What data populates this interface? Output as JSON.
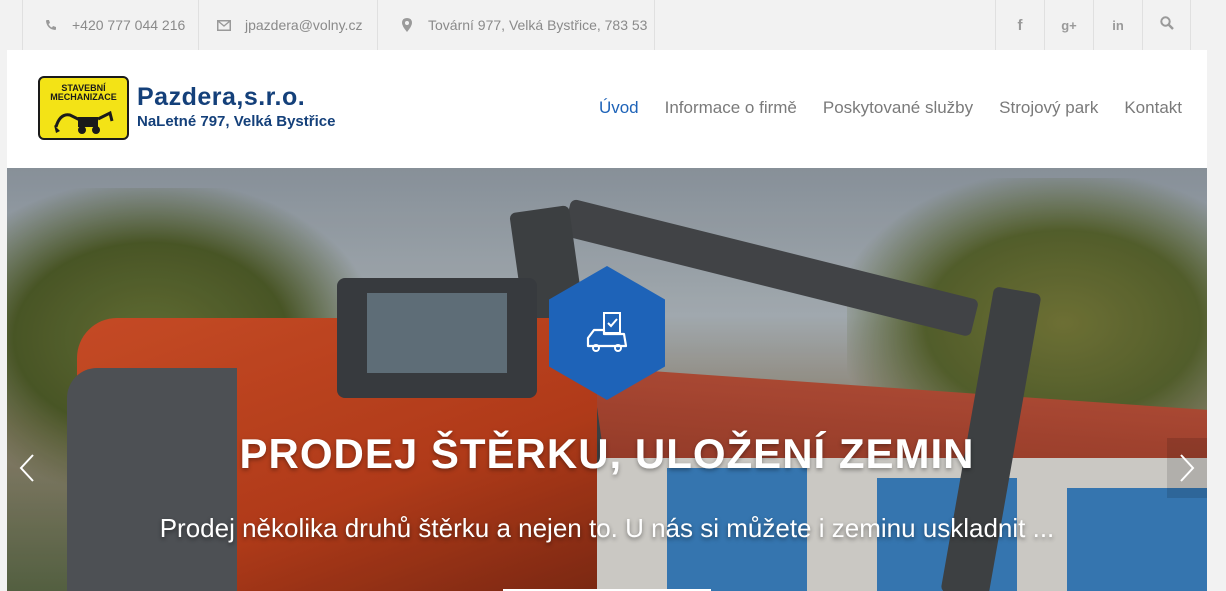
{
  "topbar": {
    "phone": "+420 777 044 216",
    "email": "jpazdera@volny.cz",
    "address": "Tovární 977, Velká Bystřice, 783 53",
    "social": [
      {
        "icon": "facebook-icon",
        "glyph": "f"
      },
      {
        "icon": "google-plus-icon",
        "glyph": "g+"
      },
      {
        "icon": "linkedin-icon",
        "glyph": "in"
      }
    ]
  },
  "logo": {
    "badge_line1": "STAVEBNÍ",
    "badge_line2": "MECHANIZACE",
    "name": "Pazdera,s.r.o.",
    "address": "NaLetné 797, Velká Bystřice"
  },
  "nav": {
    "items": [
      "Úvod",
      "Informace o firmě",
      "Poskytované služby",
      "Strojový park",
      "Kontakt"
    ],
    "active_index": 0
  },
  "slider": {
    "title": "PRODEJ ŠTĚRKU, ULOŽENÍ ZEMIN",
    "subtitle": "Prodej několika druhů štěrku a nejen to. U nás si můžete i zeminu uskladnit ...",
    "icon": "truck-checklist-icon"
  },
  "colors": {
    "accent": "#1e63b8",
    "logo_text": "#14407a",
    "logo_badge": "#f3e316",
    "topbar_bg": "#f2f2f2"
  }
}
